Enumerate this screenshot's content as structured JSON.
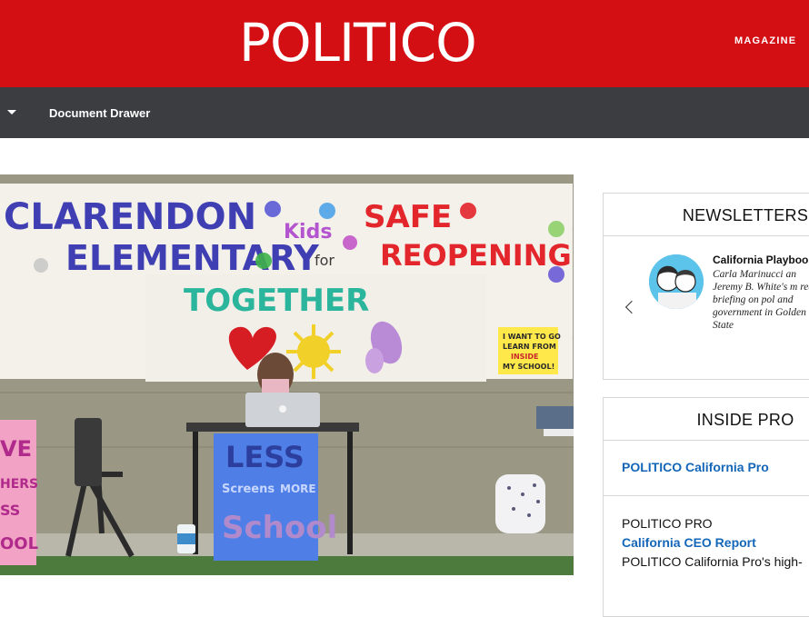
{
  "header": {
    "logo_text": "POLITICO",
    "magazine_link": "MAGAZINE",
    "brand_color": "#d40f14"
  },
  "nav": {
    "items": [
      {
        "label": "Document Drawer"
      }
    ]
  },
  "hero": {
    "banner_lines": [
      "CLARENDON",
      "ELEMENTARY",
      "Kids",
      "for",
      "SAFE",
      "REOPENING",
      "TOGETHER"
    ],
    "sign_right": [
      "I WANT TO GO",
      "LEARN FROM",
      "INSIDE",
      "MY SCHOOL!"
    ],
    "sign_table": [
      "LESS",
      "Screens",
      "MORE",
      "School"
    ],
    "sign_left": [
      "VE",
      "HERS",
      "SS",
      "OOL"
    ]
  },
  "newsletters": {
    "title": "NEWSLETTERS",
    "item": {
      "name": "California Playboo",
      "description": "Carla Marinucci an Jeremy B. White's m read briefing on pol and government in Golden State"
    }
  },
  "inside_pro": {
    "title": "INSIDE PRO",
    "primary_link": "POLITICO California Pro",
    "label": "POLITICO PRO",
    "report_link": "California CEO Report",
    "description": "POLITICO California Pro's high-"
  }
}
